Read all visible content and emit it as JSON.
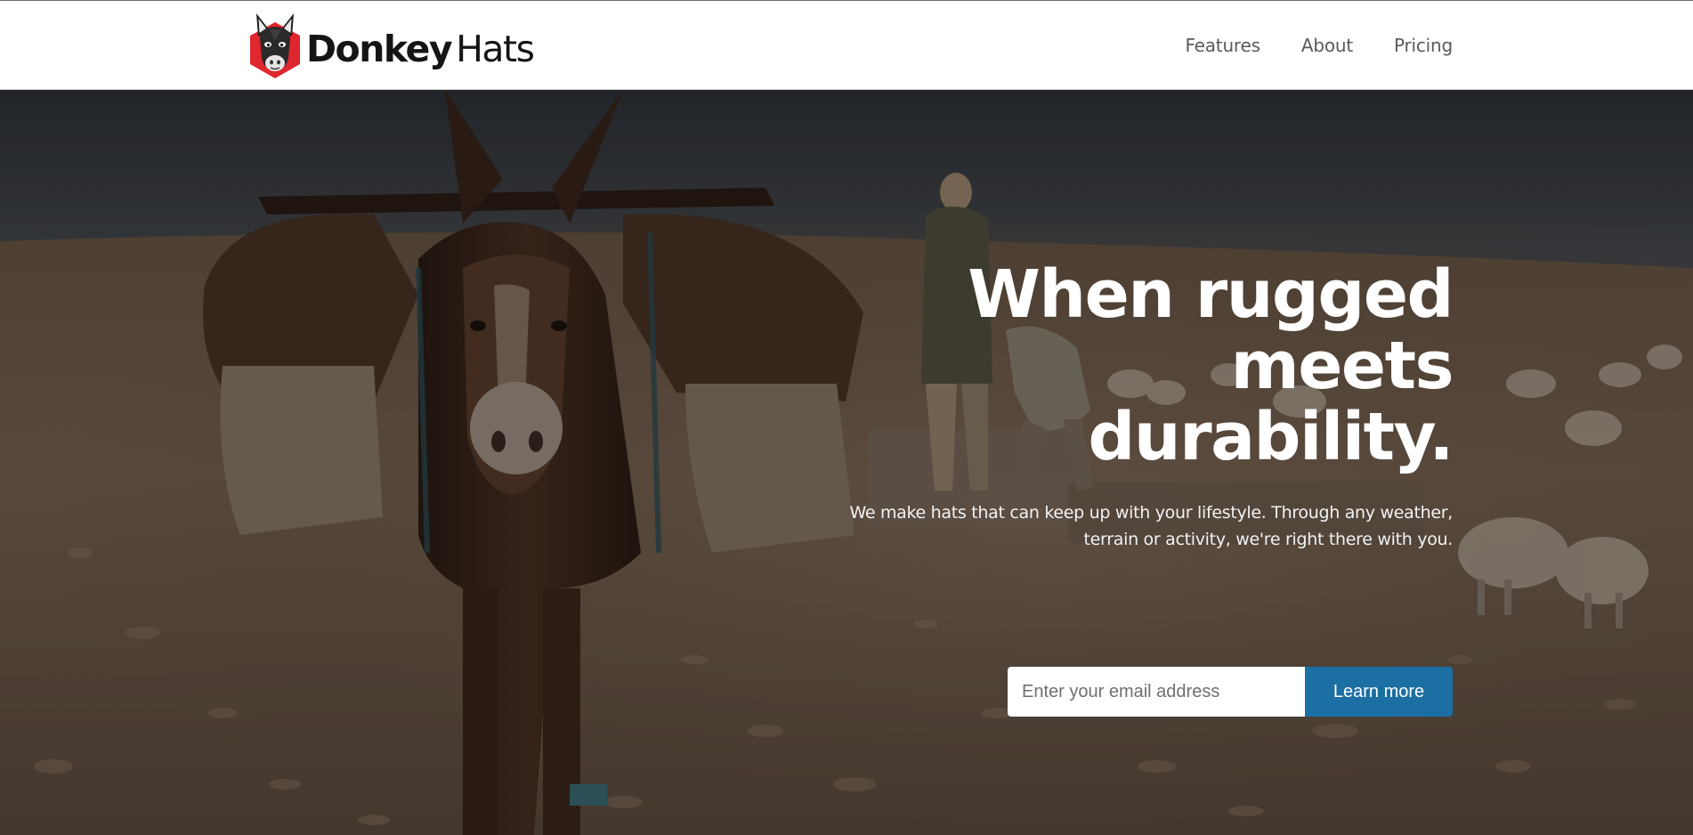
{
  "brand": {
    "name_part1": "Donkey",
    "name_part2": "Hats",
    "logo_icon": "donkey-head-icon",
    "logo_color": "#e0262e"
  },
  "nav": {
    "items": [
      {
        "label": "Features"
      },
      {
        "label": "About"
      },
      {
        "label": "Pricing"
      }
    ]
  },
  "hero": {
    "background_image": "donkey-in-desert-photo",
    "headline": {
      "line1": "When rugged",
      "line2": "meets",
      "line3": "durability."
    },
    "subtext": "We make hats that can keep up with your lifestyle. Through any weather, terrain or activity, we're right there with you.",
    "email_placeholder": "Enter your email address",
    "email_value": "",
    "cta_label": "Learn more",
    "cta_color": "#1b6fa3"
  }
}
